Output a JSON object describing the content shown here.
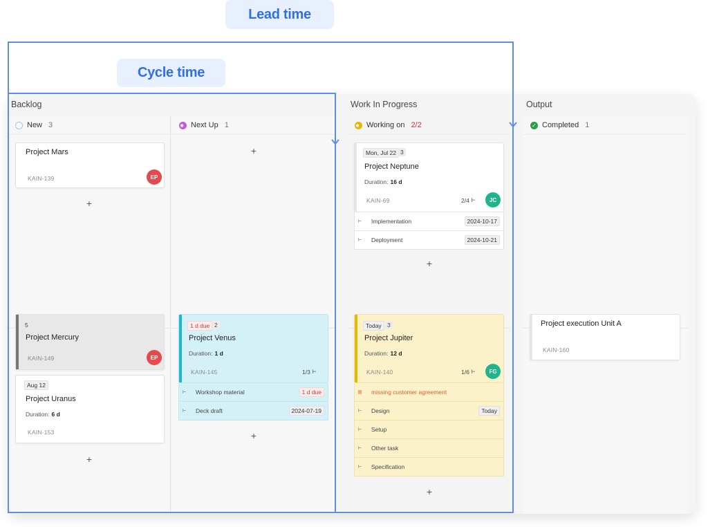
{
  "annotations": {
    "lead_time": "Lead time",
    "cycle_time": "Cycle time"
  },
  "groups": {
    "backlog": "Backlog",
    "wip": "Work In Progress",
    "output": "Output"
  },
  "columns": {
    "new": {
      "name": "New",
      "count": "3"
    },
    "next": {
      "name": "Next Up",
      "count": "1"
    },
    "working": {
      "name": "Working on",
      "count": "2/2"
    },
    "completed": {
      "name": "Completed",
      "count": "1"
    }
  },
  "cards": {
    "mars": {
      "title": "Project Mars",
      "key": "KAIN-139",
      "avatar": "EP"
    },
    "mercury": {
      "num": "5",
      "title": "Project Mercury",
      "key": "KAIN-149",
      "avatar": "EP"
    },
    "uranus": {
      "date": "Aug 12",
      "title": "Project Uranus",
      "duration_label": "Duration:",
      "duration": "6 d",
      "key": "KAIN-153"
    },
    "venus": {
      "due": "1 d due",
      "num": "2",
      "title": "Project Venus",
      "duration_label": "Duration:",
      "duration": "1 d",
      "key": "KAIN-145",
      "subcount": "1/3",
      "subtasks": [
        {
          "label": "Workshop material",
          "date": "1 d due"
        },
        {
          "label": "Deck draft",
          "date": "2024-07-19"
        }
      ]
    },
    "neptune": {
      "date": "Mon, Jul 22",
      "num": "3",
      "title": "Project Neptune",
      "duration_label": "Duration:",
      "duration": "16 d",
      "key": "KAIN-69",
      "subcount": "2/4",
      "avatar": "JC",
      "subtasks": [
        {
          "label": "Implementation",
          "date": "2024-10-17"
        },
        {
          "label": "Deployment",
          "date": "2024-10-21"
        }
      ]
    },
    "jupiter": {
      "date": "Today",
      "num": "3",
      "title": "Project Jupiter",
      "duration_label": "Duration:",
      "duration": "12 d",
      "key": "KAIN-140",
      "subcount": "1/6",
      "avatar": "FG",
      "blocker": "missing customer agreement",
      "subtasks": [
        {
          "label": "Design",
          "date": "Today"
        },
        {
          "label": "Setup",
          "date": ""
        },
        {
          "label": "Other task",
          "date": ""
        },
        {
          "label": "Specification",
          "date": ""
        }
      ]
    },
    "unit_a": {
      "title": "Project execution Unit A",
      "key": "KAIN-160"
    }
  },
  "add_symbol": "+",
  "colors": {
    "accent": "#5b8def",
    "venus": "#d4f1f8",
    "venus_stripe": "#1fb8d0",
    "jupiter": "#fbf2c9",
    "jupiter_stripe": "#e6b800",
    "mercury": "#e8e8e8",
    "mercury_stripe": "#777777"
  }
}
